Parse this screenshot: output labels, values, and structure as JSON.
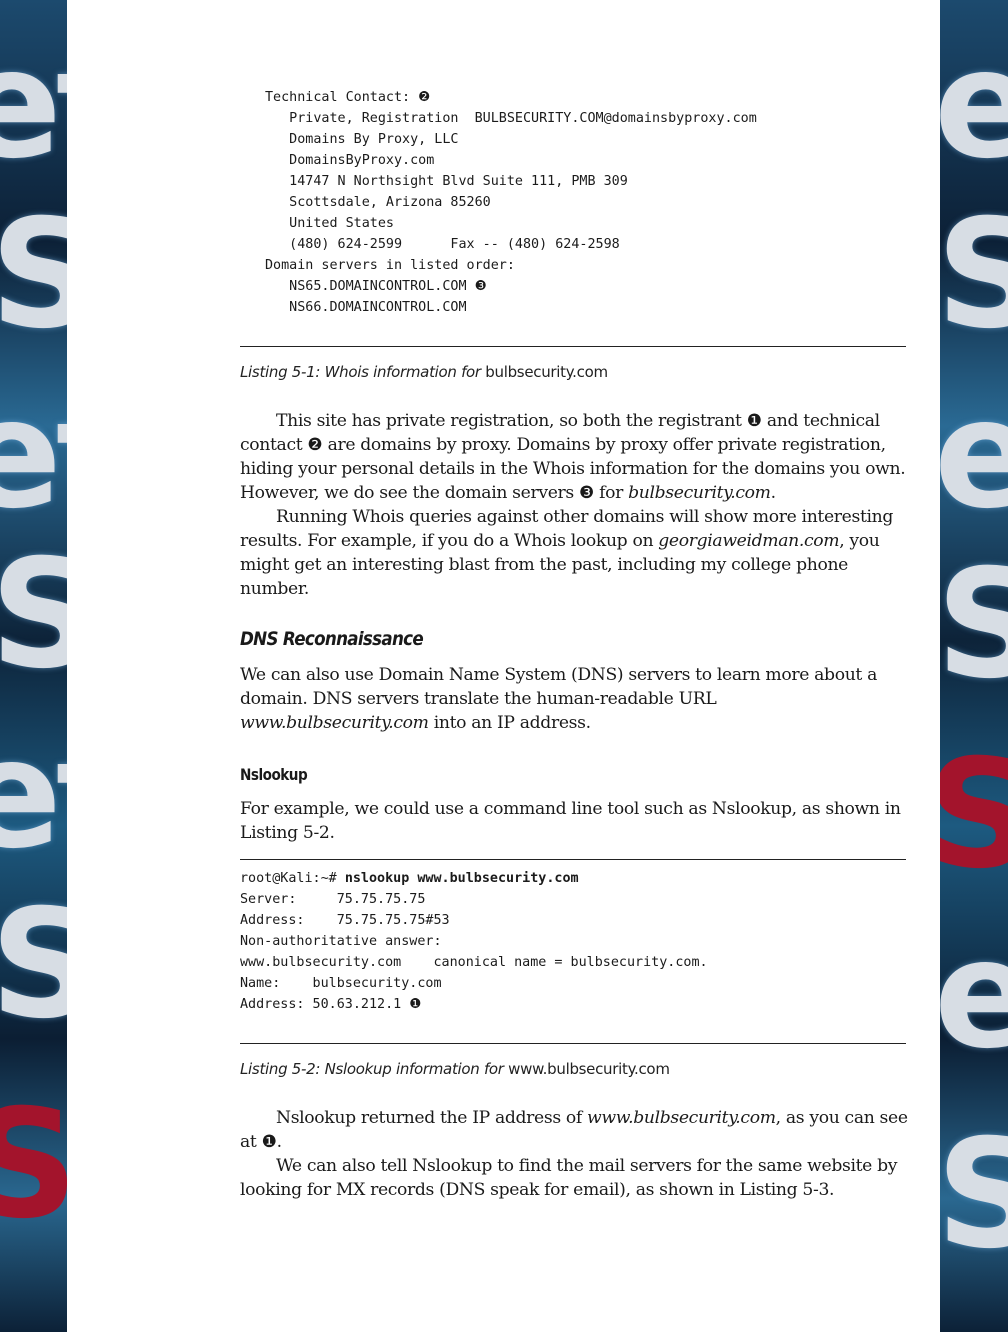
{
  "background": {
    "word_fragments": [
      "et",
      "S",
      "et",
      "S",
      "et",
      "S",
      "S"
    ],
    "colors": {
      "blue": "#1c4a6e",
      "dark": "#0b1e33",
      "red": "#a3142c",
      "light": "#d7dde4"
    }
  },
  "listing1": {
    "lines": [
      "Technical Contact: ❷",
      "   Private, Registration  BULBSECURITY.COM@domainsbyproxy.com",
      "   Domains By Proxy, LLC",
      "   DomainsByProxy.com",
      "   14747 N Northsight Blvd Suite 111, PMB 309",
      "   Scottsdale, Arizona 85260",
      "   United States",
      "   (480) 624-2599      Fax -- (480) 624-2598",
      "",
      "Domain servers in listed order:",
      "   NS65.DOMAINCONTROL.COM ❸",
      "   NS66.DOMAINCONTROL.COM"
    ],
    "caption_prefix": "Listing 5-1: Whois information for ",
    "caption_domain": "bulbsecurity.com"
  },
  "paragraphs1": {
    "p1_a": "This site has private registration, so both the registrant ❶ and technical contact ❷ are domains by proxy. Domains by proxy offer private registration, hiding your personal details in the Whois information for the domains you own. However, we do see the domain servers ❸ for ",
    "p1_domain": "bulbsecurity.com",
    "p1_end": ".",
    "p2_a": "Running Whois queries against other domains will show more interesting results. For example, if you do a Whois lookup on ",
    "p2_domain": "georgiaweidman.com",
    "p2_b": ", you might get an interesting blast from the past, including my college phone number."
  },
  "section_dns": {
    "heading": "DNS Reconnaissance",
    "p_a": "We can also use Domain Name System (DNS) servers to learn more about a domain. DNS servers translate the human-readable URL ",
    "p_url": "www.bulbsecurity.com",
    "p_b": " into an IP address."
  },
  "section_nslookup": {
    "heading": "Nslookup",
    "p": "For example, we could use a command line tool such as Nslookup, as shown in Listing 5-2."
  },
  "listing2": {
    "prompt": "root@Kali:~# ",
    "command": "nslookup www.bulbsecurity.com",
    "lines": [
      "Server:     75.75.75.75",
      "Address:    75.75.75.75#53",
      "",
      "Non-authoritative answer:",
      "www.bulbsecurity.com    canonical name = bulbsecurity.com.",
      "Name:    bulbsecurity.com",
      "Address: 50.63.212.1 ❶"
    ],
    "caption_prefix": "Listing 5-2: Nslookup information for ",
    "caption_domain": "www.bulbsecurity.com"
  },
  "paragraphs2": {
    "p1_a": "Nslookup returned the IP address of ",
    "p1_domain": "www.bulbsecurity.com",
    "p1_b": ", as you can see at ❶.",
    "p2": "We can also tell Nslookup to find the mail servers for the same website by looking for MX records (DNS speak for email), as shown in Listing 5-3."
  }
}
